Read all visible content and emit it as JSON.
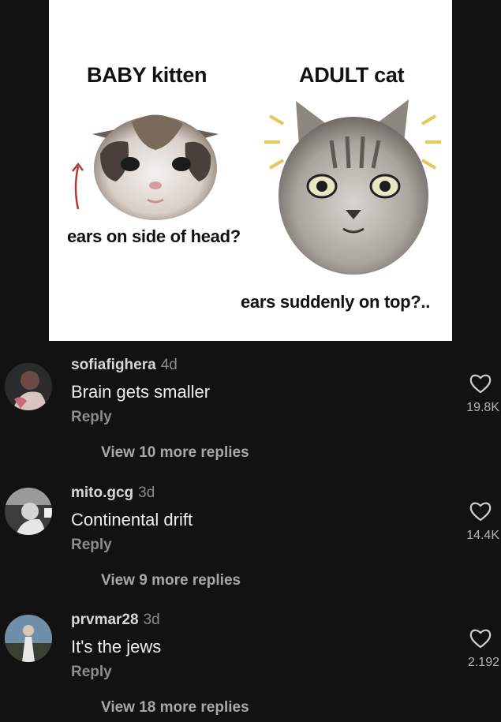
{
  "meme": {
    "caption_kitten": "BABY kitten",
    "caption_adult": "ADULT cat",
    "caption_side": "ears on side of head?",
    "caption_top": "ears suddenly on top?.."
  },
  "comments": [
    {
      "username": "sofiafighera",
      "time": "4d",
      "text": "Brain gets smaller",
      "reply": "Reply",
      "more": "View 10 more replies",
      "likes": "19.8K"
    },
    {
      "username": "mito.gcg",
      "time": "3d",
      "text": "Continental drift",
      "reply": "Reply",
      "more": "View 9 more replies",
      "likes": "14.4K"
    },
    {
      "username": "prvmar28",
      "time": "3d",
      "text": "It's the jews",
      "reply": "Reply",
      "more": "View 18 more replies",
      "likes": "2.192"
    }
  ],
  "colors": {
    "background": "#121212",
    "text": "#efefef",
    "muted": "#8d8d8d"
  }
}
